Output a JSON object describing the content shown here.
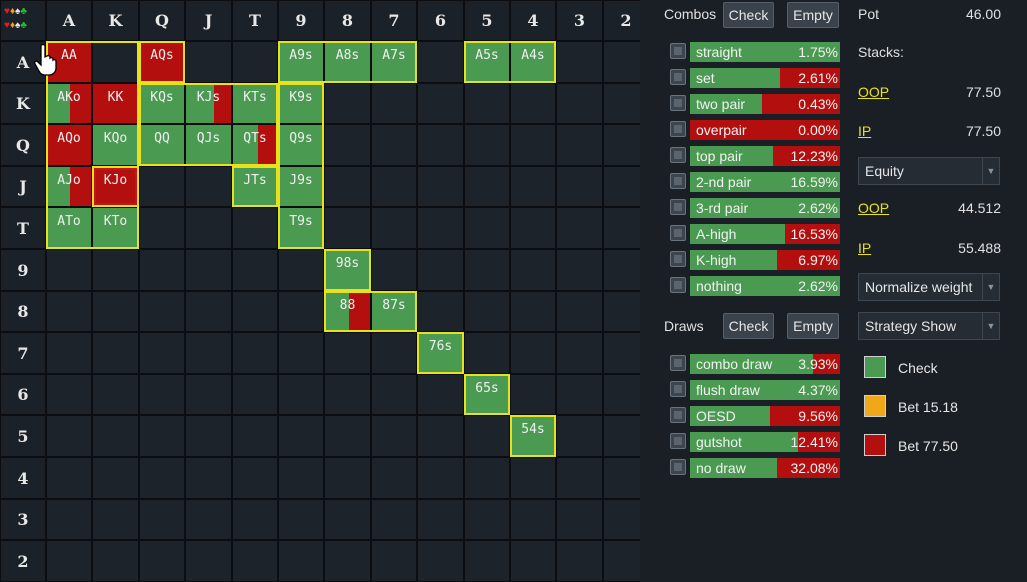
{
  "grid": {
    "ranks": [
      "A",
      "K",
      "Q",
      "J",
      "T",
      "9",
      "8",
      "7",
      "6",
      "5",
      "4",
      "3",
      "2"
    ],
    "corner_suits": [
      "♥",
      "♦",
      "♠",
      "♣"
    ],
    "cells": [
      {
        "r": 0,
        "c": 0,
        "label": "AA",
        "green": 0.0,
        "red": 1.0
      },
      {
        "r": 0,
        "c": 2,
        "label": "AQs",
        "green": 0.0,
        "red": 1.0
      },
      {
        "r": 0,
        "c": 5,
        "label": "A9s",
        "green": 1.0,
        "red": 0.0
      },
      {
        "r": 0,
        "c": 6,
        "label": "A8s",
        "green": 1.0,
        "red": 0.0
      },
      {
        "r": 0,
        "c": 7,
        "label": "A7s",
        "green": 1.0,
        "red": 0.0
      },
      {
        "r": 0,
        "c": 9,
        "label": "A5s",
        "green": 1.0,
        "red": 0.0
      },
      {
        "r": 0,
        "c": 10,
        "label": "A4s",
        "green": 1.0,
        "red": 0.0
      },
      {
        "r": 1,
        "c": 0,
        "label": "AKo",
        "green": 0.5,
        "red": 0.5
      },
      {
        "r": 1,
        "c": 1,
        "label": "KK",
        "green": 0.0,
        "red": 1.0
      },
      {
        "r": 1,
        "c": 2,
        "label": "KQs",
        "green": 1.0,
        "red": 0.0
      },
      {
        "r": 1,
        "c": 3,
        "label": "KJs",
        "green": 0.6,
        "red": 0.4
      },
      {
        "r": 1,
        "c": 4,
        "label": "KTs",
        "green": 1.0,
        "red": 0.0
      },
      {
        "r": 1,
        "c": 5,
        "label": "K9s",
        "green": 1.0,
        "red": 0.0
      },
      {
        "r": 2,
        "c": 0,
        "label": "AQo",
        "green": 0.0,
        "red": 1.0
      },
      {
        "r": 2,
        "c": 1,
        "label": "KQo",
        "green": 1.0,
        "red": 0.0
      },
      {
        "r": 2,
        "c": 2,
        "label": "QQ",
        "green": 1.0,
        "red": 0.0
      },
      {
        "r": 2,
        "c": 3,
        "label": "QJs",
        "green": 1.0,
        "red": 0.0
      },
      {
        "r": 2,
        "c": 4,
        "label": "QTs",
        "green": 0.55,
        "red": 0.45
      },
      {
        "r": 2,
        "c": 5,
        "label": "Q9s",
        "green": 1.0,
        "red": 0.0
      },
      {
        "r": 3,
        "c": 0,
        "label": "AJo",
        "green": 0.5,
        "red": 0.5
      },
      {
        "r": 3,
        "c": 1,
        "label": "KJo",
        "green": 0.0,
        "red": 1.0
      },
      {
        "r": 3,
        "c": 4,
        "label": "JTs",
        "green": 1.0,
        "red": 0.0
      },
      {
        "r": 3,
        "c": 5,
        "label": "J9s",
        "green": 1.0,
        "red": 0.0
      },
      {
        "r": 4,
        "c": 0,
        "label": "ATo",
        "green": 1.0,
        "red": 0.0
      },
      {
        "r": 4,
        "c": 1,
        "label": "KTo",
        "green": 1.0,
        "red": 0.0
      },
      {
        "r": 4,
        "c": 5,
        "label": "T9s",
        "green": 1.0,
        "red": 0.0
      },
      {
        "r": 5,
        "c": 6,
        "label": "98s",
        "green": 1.0,
        "red": 0.0
      },
      {
        "r": 6,
        "c": 6,
        "label": "88",
        "green": 0.5,
        "red": 0.5
      },
      {
        "r": 6,
        "c": 7,
        "label": "87s",
        "green": 1.0,
        "red": 0.0
      },
      {
        "r": 7,
        "c": 8,
        "label": "76s",
        "green": 1.0,
        "red": 0.0
      },
      {
        "r": 8,
        "c": 9,
        "label": "65s",
        "green": 1.0,
        "red": 0.0
      },
      {
        "r": 9,
        "c": 10,
        "label": "54s",
        "green": 1.0,
        "red": 0.0
      }
    ]
  },
  "combos": {
    "title": "Combos",
    "check_label": "Check",
    "empty_label": "Empty",
    "rows": [
      {
        "name": "straight",
        "value": "1.75%",
        "green": 1.0
      },
      {
        "name": "set",
        "value": "2.61%",
        "green": 0.6
      },
      {
        "name": "two pair",
        "value": "0.43%",
        "green": 0.48
      },
      {
        "name": "overpair",
        "value": "0.00%",
        "green": 0.0
      },
      {
        "name": "top pair",
        "value": "12.23%",
        "green": 0.55
      },
      {
        "name": "2-nd pair",
        "value": "16.59%",
        "green": 1.0
      },
      {
        "name": "3-rd pair",
        "value": "2.62%",
        "green": 1.0
      },
      {
        "name": "A-high",
        "value": "16.53%",
        "green": 0.63
      },
      {
        "name": "K-high",
        "value": "6.97%",
        "green": 0.58
      },
      {
        "name": "nothing",
        "value": "2.62%",
        "green": 1.0
      }
    ]
  },
  "draws": {
    "title": "Draws",
    "check_label": "Check",
    "empty_label": "Empty",
    "rows": [
      {
        "name": "combo draw",
        "value": "3.93%",
        "green": 0.82
      },
      {
        "name": "flush draw",
        "value": "4.37%",
        "green": 1.0
      },
      {
        "name": "OESD",
        "value": "9.56%",
        "green": 0.53
      },
      {
        "name": "gutshot",
        "value": "12.41%",
        "green": 0.72
      },
      {
        "name": "no draw",
        "value": "32.08%",
        "green": 0.58
      }
    ]
  },
  "info": {
    "pot_label": "Pot",
    "pot_value": "46.00",
    "stacks_label": "Stacks:",
    "oop_label": "OOP",
    "oop_stack": "77.50",
    "ip_label": "IP",
    "ip_stack": "77.50",
    "equity_select": "Equity",
    "oop_equity": "44.512",
    "ip_equity": "55.488",
    "normalize_select": "Normalize weight",
    "strategy_select": "Strategy Show"
  },
  "legend": [
    {
      "label": "Check",
      "color": "#4a9a52"
    },
    {
      "label": "Bet 15.18",
      "color": "#f0a818"
    },
    {
      "label": "Bet 77.50",
      "color": "#b30f0f"
    }
  ],
  "colors": {
    "check": "#4a9a52",
    "bet_small": "#f0a818",
    "bet_big": "#b30f0f",
    "highlight": "#e8e21c"
  }
}
